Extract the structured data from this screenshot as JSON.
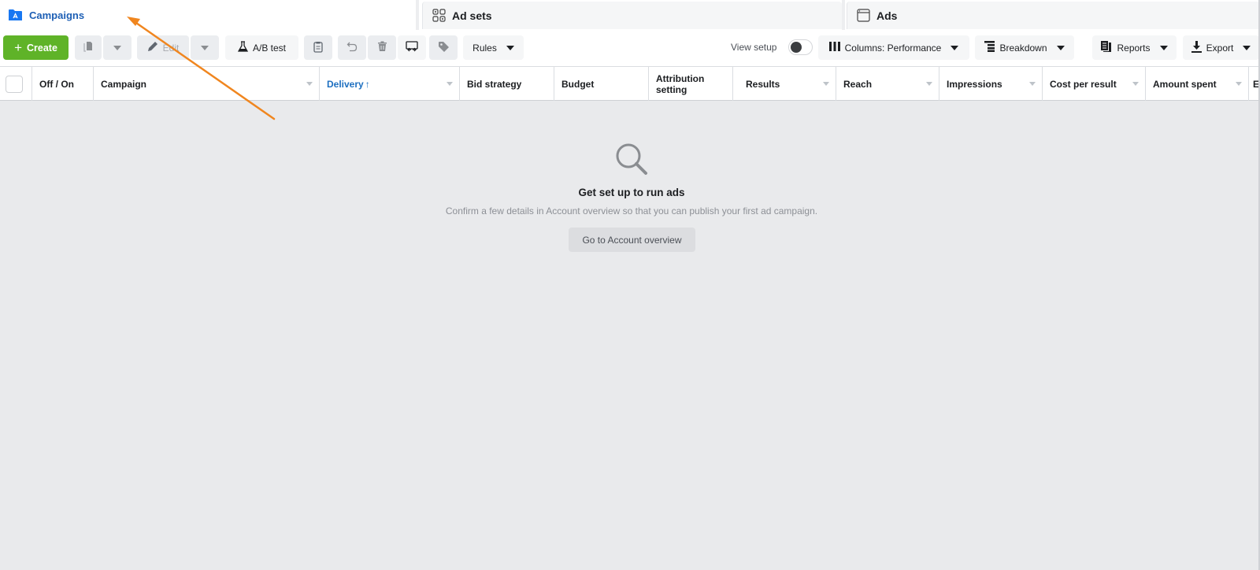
{
  "tabs": [
    {
      "label": "Campaigns",
      "icon": "campaign-folder-icon",
      "active": true
    },
    {
      "label": "Ad sets",
      "icon": "ad-sets-grid-icon",
      "active": false
    },
    {
      "label": "Ads",
      "icon": "ad-window-icon",
      "active": false
    }
  ],
  "toolbar": {
    "create_label": "Create",
    "edit_label": "Edit",
    "ab_test_label": "A/B test",
    "rules_label": "Rules",
    "view_setup_label": "View setup",
    "view_setup_on": false,
    "columns_label": "Columns: Performance",
    "breakdown_label": "Breakdown",
    "reports_label": "Reports",
    "export_label": "Export"
  },
  "table": {
    "columns": [
      {
        "label": "Off / On"
      },
      {
        "label": "Campaign"
      },
      {
        "label": "Delivery",
        "sorted": "ascending"
      },
      {
        "label": "Bid strategy"
      },
      {
        "label": "Budget"
      },
      {
        "label": "Attribution setting"
      },
      {
        "label": "Results"
      },
      {
        "label": "Reach"
      },
      {
        "label": "Impressions"
      },
      {
        "label": "Cost per result"
      },
      {
        "label": "Amount spent"
      },
      {
        "label": "En"
      }
    ],
    "sort_arrow": "↑"
  },
  "empty_state": {
    "title": "Get set up to run ads",
    "description": "Confirm a few details in Account overview so that you can publish your first ad campaign.",
    "button_label": "Go to Account overview"
  },
  "colors": {
    "create_green": "#5fb328",
    "active_tab_blue": "#1d5fb5",
    "annotation_orange": "#f0861f"
  }
}
